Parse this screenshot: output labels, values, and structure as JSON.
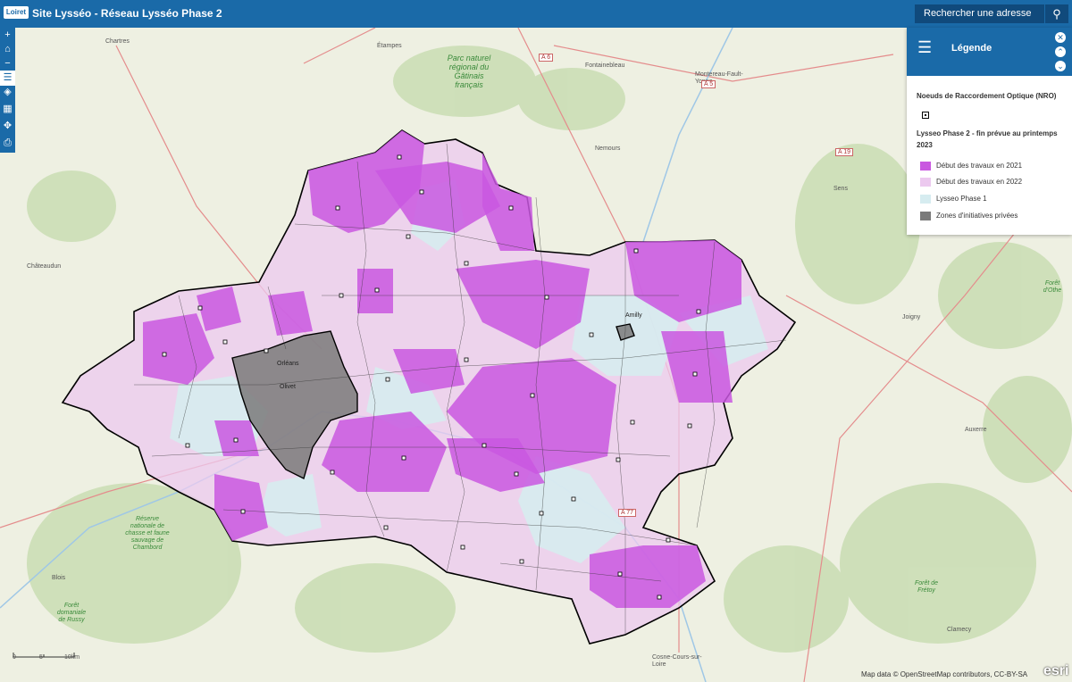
{
  "header": {
    "logo_text": "Loiret",
    "title": "Site Lysséo - Réseau Lysséo Phase 2",
    "search_placeholder": "Rechercher une adresse",
    "search_icon": "search-icon"
  },
  "toolbar": {
    "buttons": [
      {
        "name": "zoom-in",
        "glyph": "+"
      },
      {
        "name": "home",
        "glyph": "⌂"
      },
      {
        "name": "zoom-out",
        "glyph": "−"
      },
      {
        "name": "legend",
        "glyph": "☰"
      },
      {
        "name": "layers",
        "glyph": "◈"
      },
      {
        "name": "basemap",
        "glyph": "▦"
      },
      {
        "name": "locate",
        "glyph": "✥"
      },
      {
        "name": "print",
        "glyph": "⎙"
      }
    ]
  },
  "legend": {
    "title": "Légende",
    "section1": "Noeuds de Raccordement Optique (NRO)",
    "section2": "Lysseo Phase 2 - fin prévue au printemps 2023",
    "items": [
      {
        "label": "Début des travaux en 2021",
        "color": "#c957e0"
      },
      {
        "label": "Début des travaux en 2022",
        "color": "#ecc9ef"
      },
      {
        "label": "Lysseo Phase 1",
        "color": "#d6ecf0"
      },
      {
        "label": "Zones d'initiatives privées",
        "color": "#7a7a7a"
      }
    ]
  },
  "map": {
    "places": [
      "Chartres",
      "Étampes",
      "Fontainebleau",
      "Montereau-Fault-Yonne",
      "Nemours",
      "Sens",
      "Châteaudun",
      "Joigny",
      "Orléans",
      "Olivet",
      "Amilly",
      "Auxerre",
      "Blois",
      "Clamecy",
      "Cosne-Cours-sur-Loire"
    ],
    "parks": [
      "Parc naturel régional du Gâtinais français",
      "Réserve nationale de chasse et faune sauvage de Chambord",
      "Forêt domaniale de Russy",
      "Forêt d'Othe",
      "Forêt de Frétoy"
    ],
    "roads": [
      "A 6",
      "A 5",
      "A 19",
      "A 77"
    ]
  },
  "scale": {
    "labels": [
      "0",
      "5",
      "10km"
    ]
  },
  "attribution": "Map data © OpenStreetMap contributors, CC-BY-SA",
  "esri": "esri"
}
